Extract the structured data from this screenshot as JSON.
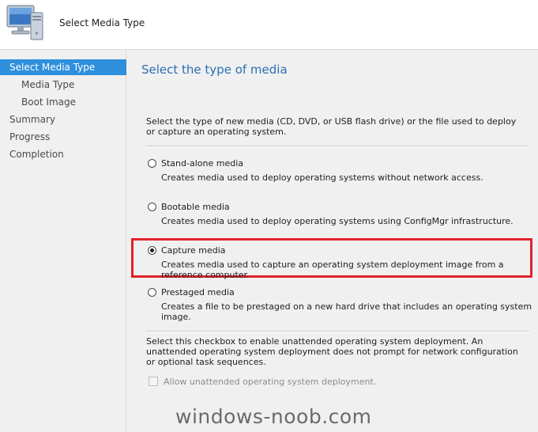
{
  "header": {
    "title": "Select Media Type",
    "icon": "computer-icon"
  },
  "sidebar": {
    "items": [
      {
        "label": "Select Media Type",
        "active": true
      },
      {
        "label": "Media Type",
        "active": false
      },
      {
        "label": "Boot Image",
        "active": false
      },
      {
        "label": "Summary",
        "active": false
      },
      {
        "label": "Progress",
        "active": false
      },
      {
        "label": "Completion",
        "active": false
      }
    ]
  },
  "main": {
    "title": "Select the type of media",
    "description": "Select the type of new media (CD, DVD, or USB flash drive) or the file used to deploy or capture an operating system.",
    "options": [
      {
        "label": "Stand-alone media",
        "description": "Creates media used to deploy operating systems without network access.",
        "selected": false
      },
      {
        "label": "Bootable media",
        "description": "Creates media used to deploy operating systems using ConfigMgr infrastructure.",
        "selected": false
      },
      {
        "label": "Capture media",
        "description": "Creates media used to capture an operating system deployment image from a reference computer.",
        "selected": true
      },
      {
        "label": "Prestaged media",
        "description": "Creates a file to be prestaged on a new hard drive that includes an operating system image.",
        "selected": false
      }
    ],
    "unattended_description": "Select this checkbox to enable unattended operating system deployment. An unattended operating system deployment does not prompt for network configuration or optional task sequences.",
    "checkbox_label": "Allow unattended operating system deployment.",
    "checkbox_checked": false,
    "checkbox_enabled": false
  },
  "watermark": "windows-noob.com",
  "colors": {
    "accent": "#2e8fdc",
    "title_blue": "#2a6fb2",
    "highlight_red": "#e0232a",
    "panel_bg": "#f0f0f0"
  }
}
